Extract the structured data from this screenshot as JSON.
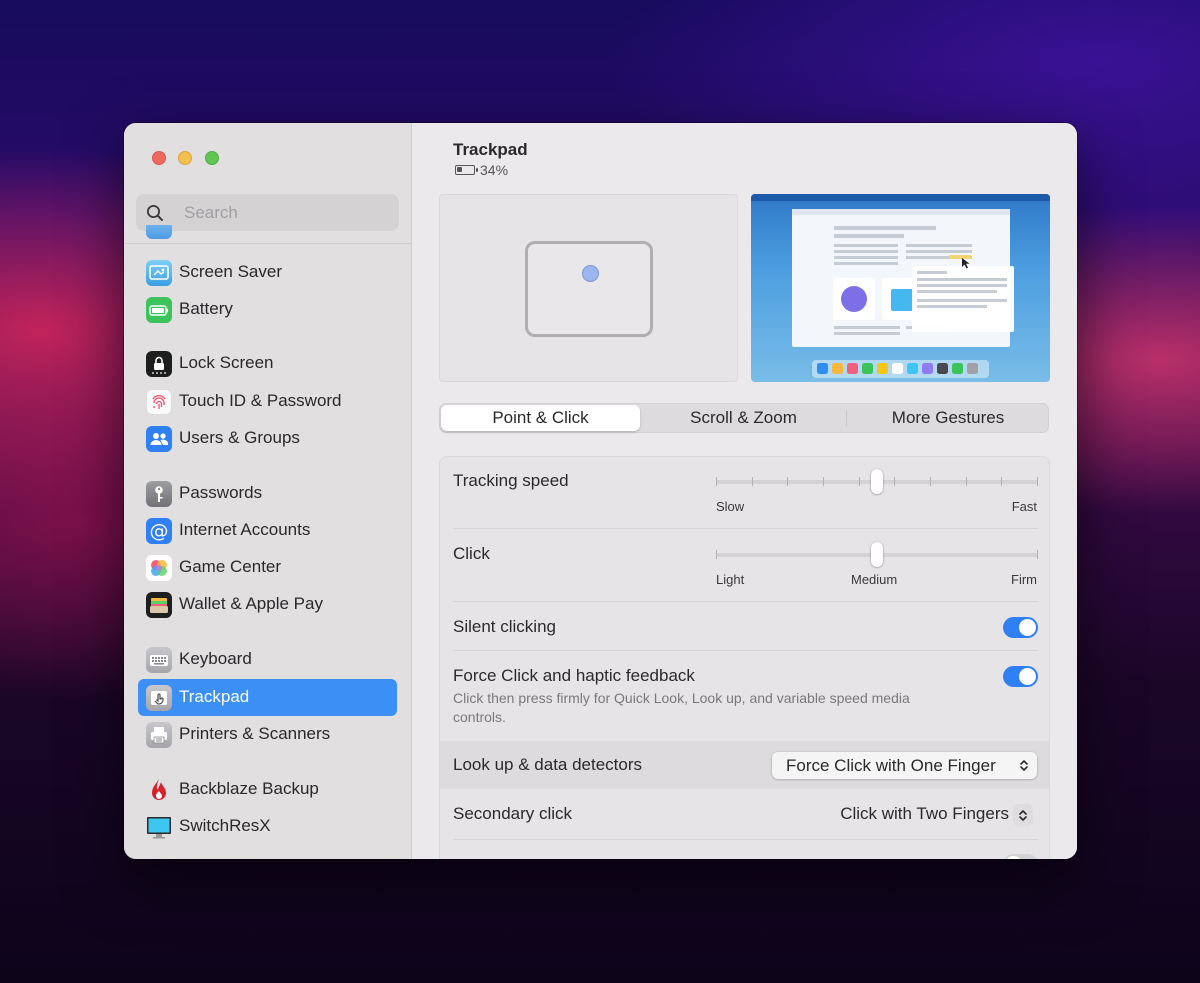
{
  "sidebar": {
    "search_placeholder": "Search",
    "items": [
      {
        "label": "Screen Saver",
        "icon": "screen-saver-icon"
      },
      {
        "label": "Battery",
        "icon": "battery-icon"
      },
      {
        "label": "Lock Screen",
        "icon": "lock-screen-icon"
      },
      {
        "label": "Touch ID & Password",
        "icon": "fingerprint-icon"
      },
      {
        "label": "Users & Groups",
        "icon": "users-icon"
      },
      {
        "label": "Passwords",
        "icon": "key-icon"
      },
      {
        "label": "Internet Accounts",
        "icon": "at-icon"
      },
      {
        "label": "Game Center",
        "icon": "game-center-icon"
      },
      {
        "label": "Wallet & Apple Pay",
        "icon": "wallet-icon"
      },
      {
        "label": "Keyboard",
        "icon": "keyboard-icon"
      },
      {
        "label": "Trackpad",
        "icon": "trackpad-icon",
        "selected": true
      },
      {
        "label": "Printers & Scanners",
        "icon": "printer-icon"
      },
      {
        "label": "Backblaze Backup",
        "icon": "flame-icon"
      },
      {
        "label": "SwitchResX",
        "icon": "monitor-icon"
      }
    ]
  },
  "header": {
    "title": "Trackpad",
    "battery_percent": "34%",
    "battery_level": 0.34
  },
  "tabs": [
    "Point & Click",
    "Scroll & Zoom",
    "More Gestures"
  ],
  "settings": {
    "tracking_speed": {
      "label": "Tracking speed",
      "min_label": "Slow",
      "max_label": "Fast",
      "ticks": 10,
      "value_index": 4
    },
    "click": {
      "label": "Click",
      "min_label": "Light",
      "mid_label": "Medium",
      "max_label": "Firm",
      "ticks": 3,
      "value_index": 1
    },
    "silent_clicking": {
      "label": "Silent clicking",
      "on": true
    },
    "force_click": {
      "label": "Force Click and haptic feedback",
      "description": "Click then press firmly for Quick Look, Look up, and variable speed media controls.",
      "on": true
    },
    "lookup": {
      "label": "Look up & data detectors",
      "value": "Force Click with One Finger"
    },
    "secondary_click": {
      "label": "Secondary click",
      "value": "Click with Two Fingers"
    }
  },
  "colors": {
    "accent": "#3b8ff5",
    "toggle_on": "#2f7ff5",
    "traffic_red": "#ed6a5e",
    "traffic_yellow": "#f5bf4f",
    "traffic_green": "#61c554"
  }
}
